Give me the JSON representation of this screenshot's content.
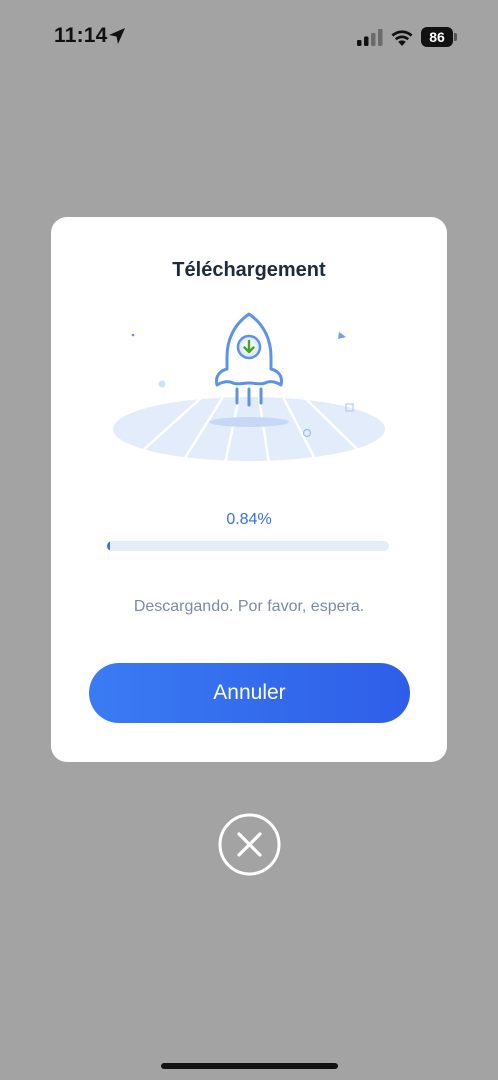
{
  "status_bar": {
    "time": "11:14",
    "battery": "86",
    "icons": [
      "location-arrow-icon",
      "signal-icon",
      "wifi-icon",
      "battery-icon"
    ]
  },
  "dialog": {
    "title": "Téléchargement",
    "illustration": "rocket-download-icon",
    "progress": {
      "label": "0.84%",
      "fraction": 0.0084
    },
    "status_text": "Descargando. Por favor, espera.",
    "cancel_label": "Annuler"
  },
  "close_button": {
    "icon": "close-circle-icon"
  },
  "colors": {
    "overlay": "#a3a3a3",
    "accent": "#3470e6",
    "button_start": "#3a7bf3",
    "button_end": "#2e5ee8",
    "title": "#1f2a3d",
    "muted": "#7d8aa3",
    "track": "#e6edf9"
  }
}
